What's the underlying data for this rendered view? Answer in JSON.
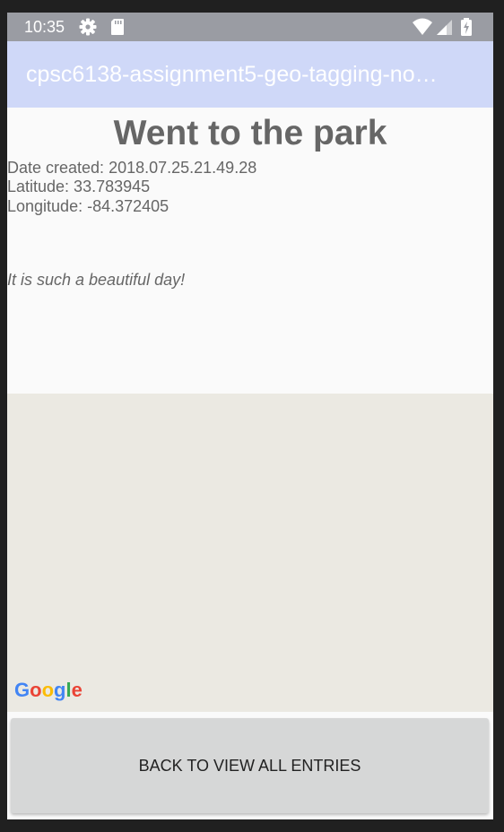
{
  "status_bar": {
    "time": "10:35",
    "icons": [
      "gear-icon",
      "sd-card-icon",
      "wifi-icon",
      "signal-icon",
      "battery-charging-icon"
    ]
  },
  "app_bar": {
    "title": "cpsc6138-assignment5-geo-tagging-no…"
  },
  "note": {
    "title": "Went to the park",
    "date_created": "Date created: 2018.07.25.21.49.28",
    "latitude": "Latitude: 33.783945",
    "longitude": "Longitude: -84.372405",
    "body": "It is such a beautiful day!"
  },
  "map": {
    "logo_letters": [
      "G",
      "o",
      "o",
      "g",
      "l",
      "e"
    ],
    "logo_colors": [
      "#4285F4",
      "#EA4335",
      "#FBBC05",
      "#4285F4",
      "#34A853",
      "#EA4335"
    ]
  },
  "actions": {
    "back_label": "BACK TO VIEW ALL ENTRIES"
  },
  "colors": {
    "status_bar": "#9a9ca3",
    "app_bar": "#cfd8f8",
    "map_background": "#ebe9e2",
    "button": "#d6d7d7",
    "text": "#666666"
  }
}
